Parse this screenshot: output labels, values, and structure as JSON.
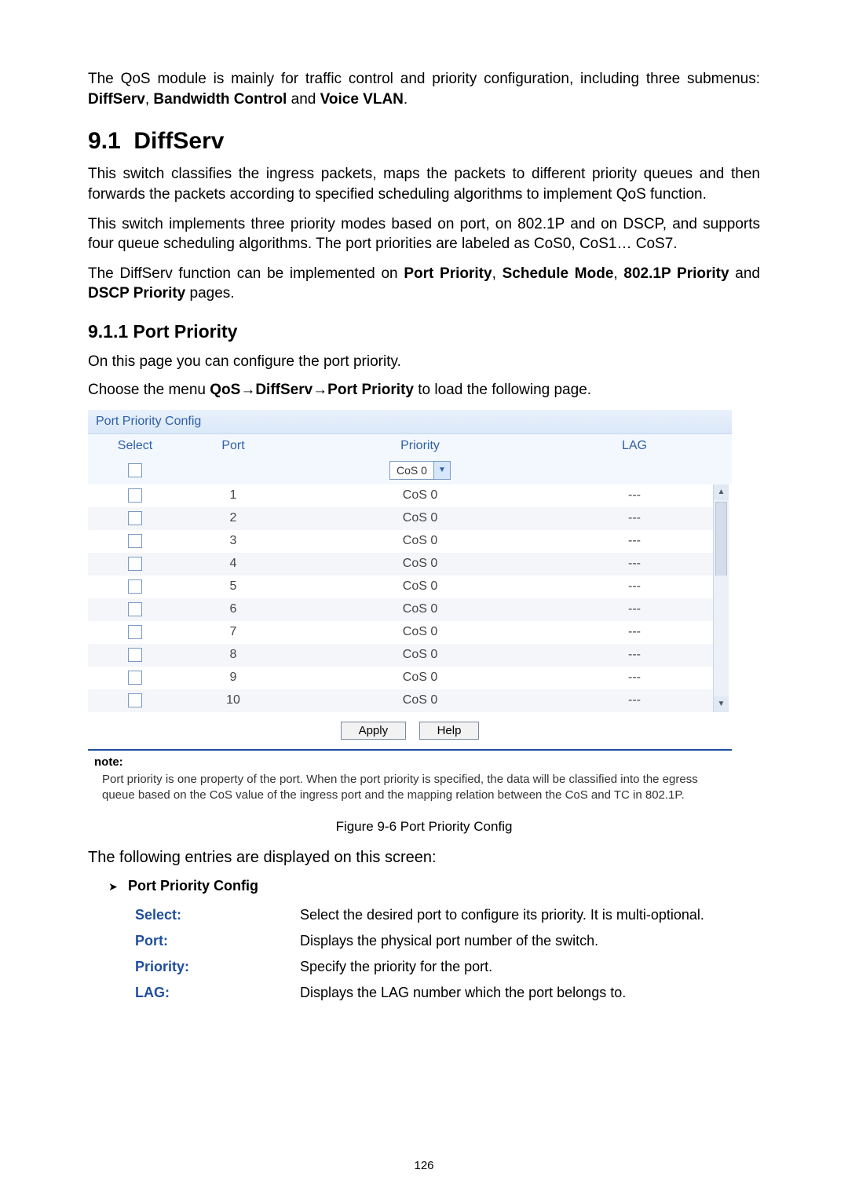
{
  "intro": {
    "text": "The QoS module is mainly for traffic control and priority configuration, including three submenus: ",
    "bold_items": [
      "DiffServ",
      "Bandwidth Control",
      "Voice VLAN"
    ],
    "joiner1": ", ",
    "joiner2": " and ",
    "tail": "."
  },
  "section": {
    "number": "9.1",
    "title": "DiffServ",
    "para1": "This switch classifies the ingress packets, maps the packets to different priority queues and then forwards the packets according to specified scheduling algorithms to implement QoS function.",
    "para2": "This switch implements three priority modes based on port, on 802.1P and on DSCP, and supports four queue scheduling algorithms. The port priorities are labeled as CoS0, CoS1… CoS7.",
    "para3_pre": "The DiffServ function can be implemented on ",
    "para3_items": [
      "Port Priority",
      "Schedule Mode",
      "802.1P Priority",
      "DSCP Priority"
    ],
    "para3_mid1": ", ",
    "para3_mid2": ", ",
    "para3_mid3": " and ",
    "para3_tail": " pages."
  },
  "subsection": {
    "number": "9.1.1",
    "title": "Port Priority",
    "intro": "On this page you can configure the port priority.",
    "menu_pre": "Choose the menu ",
    "menu_path": "QoS→DiffServ→Port Priority",
    "menu_tail": " to load the following page."
  },
  "panel": {
    "title": "Port Priority Config",
    "headers": {
      "select": "Select",
      "port": "Port",
      "priority": "Priority",
      "lag": "LAG"
    },
    "master_select_value": "CoS 0",
    "rows": [
      {
        "port": "1",
        "priority": "CoS 0",
        "lag": "---"
      },
      {
        "port": "2",
        "priority": "CoS 0",
        "lag": "---"
      },
      {
        "port": "3",
        "priority": "CoS 0",
        "lag": "---"
      },
      {
        "port": "4",
        "priority": "CoS 0",
        "lag": "---"
      },
      {
        "port": "5",
        "priority": "CoS 0",
        "lag": "---"
      },
      {
        "port": "6",
        "priority": "CoS 0",
        "lag": "---"
      },
      {
        "port": "7",
        "priority": "CoS 0",
        "lag": "---"
      },
      {
        "port": "8",
        "priority": "CoS 0",
        "lag": "---"
      },
      {
        "port": "9",
        "priority": "CoS 0",
        "lag": "---"
      },
      {
        "port": "10",
        "priority": "CoS 0",
        "lag": "---"
      }
    ],
    "buttons": {
      "apply": "Apply",
      "help": "Help"
    },
    "note_label": "note:",
    "note_body": "Port priority is one property of the port. When the port priority is specified, the data will be classified into the egress queue based on the CoS value of the ingress port and the mapping relation between the CoS and TC in 802.1P."
  },
  "figure_caption": "Figure 9-6 Port Priority Config",
  "entries_intro": "The following entries are displayed on this screen:",
  "entries_header": "Port Priority Config",
  "legend": [
    {
      "key": "Select:",
      "desc": "Select the desired port to configure its priority. It is multi-optional."
    },
    {
      "key": "Port:",
      "desc": "Displays the physical port number of the switch."
    },
    {
      "key": "Priority:",
      "desc": "Specify the priority for the port."
    },
    {
      "key": "LAG:",
      "desc": "Displays the LAG number which the port belongs to."
    }
  ],
  "page_number": "126"
}
